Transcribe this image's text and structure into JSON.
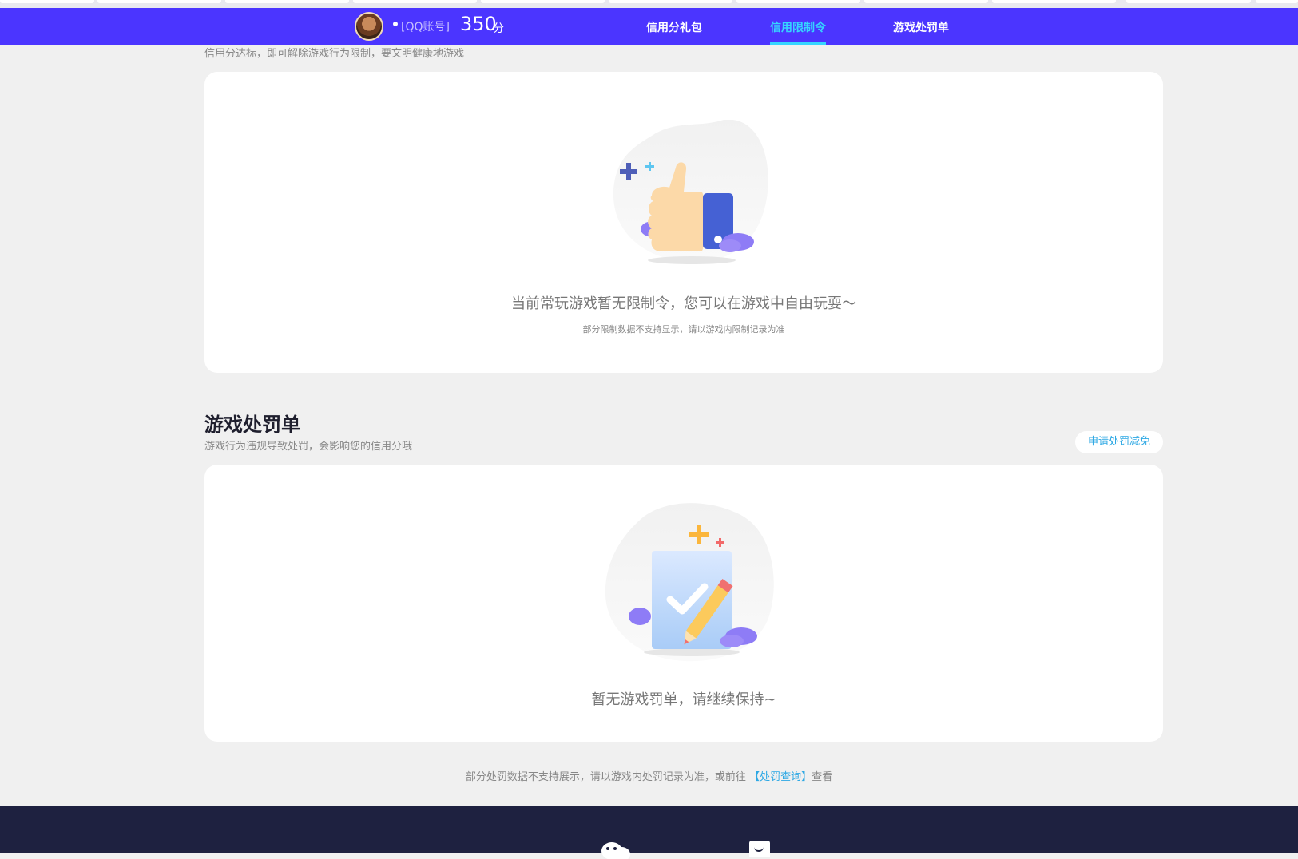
{
  "header": {
    "account_label": "[QQ账号]",
    "score": "350",
    "score_unit": "分",
    "nav": [
      {
        "label": "信用分礼包",
        "active": false
      },
      {
        "label": "信用限制令",
        "active": true
      },
      {
        "label": "游戏处罚单",
        "active": false
      }
    ],
    "accent_color": "#4b35ff",
    "active_color": "#35d5ff"
  },
  "restriction": {
    "subtitle": "信用分达标，即可解除游戏行为限制，要文明健康地游戏",
    "empty_message": "当前常玩游戏暂无限制令，您可以在游戏中自由玩耍～",
    "empty_note": "部分限制数据不支持显示，请以游戏内限制记录为准"
  },
  "penalty": {
    "title": "游戏处罚单",
    "subtitle": "游戏行为违规导致处罚，会影响您的信用分哦",
    "apply_button": "申请处罚减免",
    "empty_message": "暂无游戏罚单，请继续保持~"
  },
  "footer": {
    "note_prefix": "部分处罚数据不支持展示，请以游戏内处罚记录为准，或前往",
    "note_link": "【处罚查询】",
    "note_suffix": "查看"
  }
}
